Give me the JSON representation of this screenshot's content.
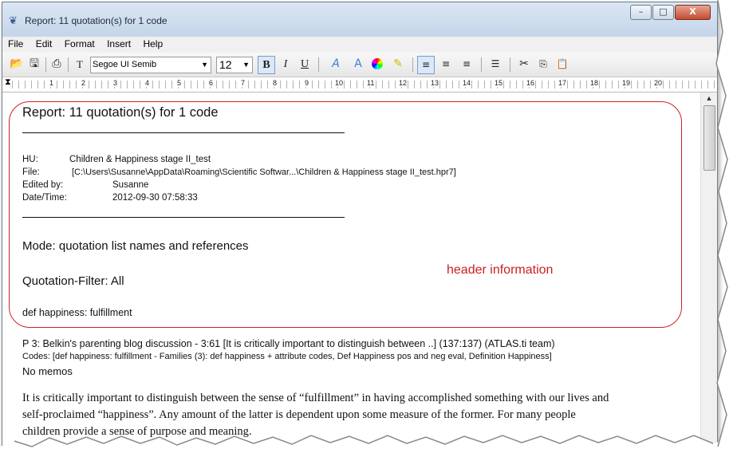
{
  "window": {
    "title": "Report: 11 quotation(s) for 1 code",
    "controls": {
      "minimize": "–",
      "maximize": "□",
      "close": "X"
    }
  },
  "menu": [
    "File",
    "Edit",
    "Format",
    "Insert",
    "Help"
  ],
  "toolbar": {
    "font_name": "Segoe UI Semib",
    "font_size": "12",
    "bold": "B",
    "italic": "I",
    "underline": "U"
  },
  "ruler": [
    "1",
    "2",
    "3",
    "4",
    "5",
    "6",
    "7",
    "8",
    "9",
    "10",
    "11",
    "12",
    "13",
    "14",
    "15",
    "16",
    "17",
    "18",
    "19",
    "20"
  ],
  "report": {
    "title": "Report: 11 quotation(s) for 1 code",
    "hu_label": "HU:",
    "hu_value": "Children & Happiness stage II_test",
    "file_label": "File:",
    "file_value": "[C:\\Users\\Susanne\\AppData\\Roaming\\Scientific Softwar...\\Children & Happiness stage II_test.hpr7]",
    "edited_label": "Edited by:",
    "edited_value": "Susanne",
    "datetime_label": "Date/Time:",
    "datetime_value": "2012-09-30 07:58:33",
    "mode": "Mode: quotation list names and references",
    "filter": "Quotation-Filter: All",
    "code": "def happiness: fulfillment"
  },
  "annotation": "header information",
  "quotation": {
    "header": "P 3: Belkin's parenting blog discussion - 3:61 [It is critically important to distinguish between ..]  (137:137)   (ATLAS.ti team)",
    "codes": "Codes:    [def happiness: fulfillment - Families (3): def happiness + attribute codes, Def Happiness pos and neg eval, Definition Happiness]",
    "memos": "No memos",
    "text_line1": "It is critically important to distinguish between the sense of “fulfillment” in having accomplished something with our lives and",
    "text_line2": "self-proclaimed “happiness”. Any amount of the latter is dependent upon some measure of the former. For many people",
    "text_line3": "children provide a sense of purpose and meaning."
  },
  "colors": {
    "callout": "#cc2222",
    "titlebar": "#c4d5ea"
  }
}
